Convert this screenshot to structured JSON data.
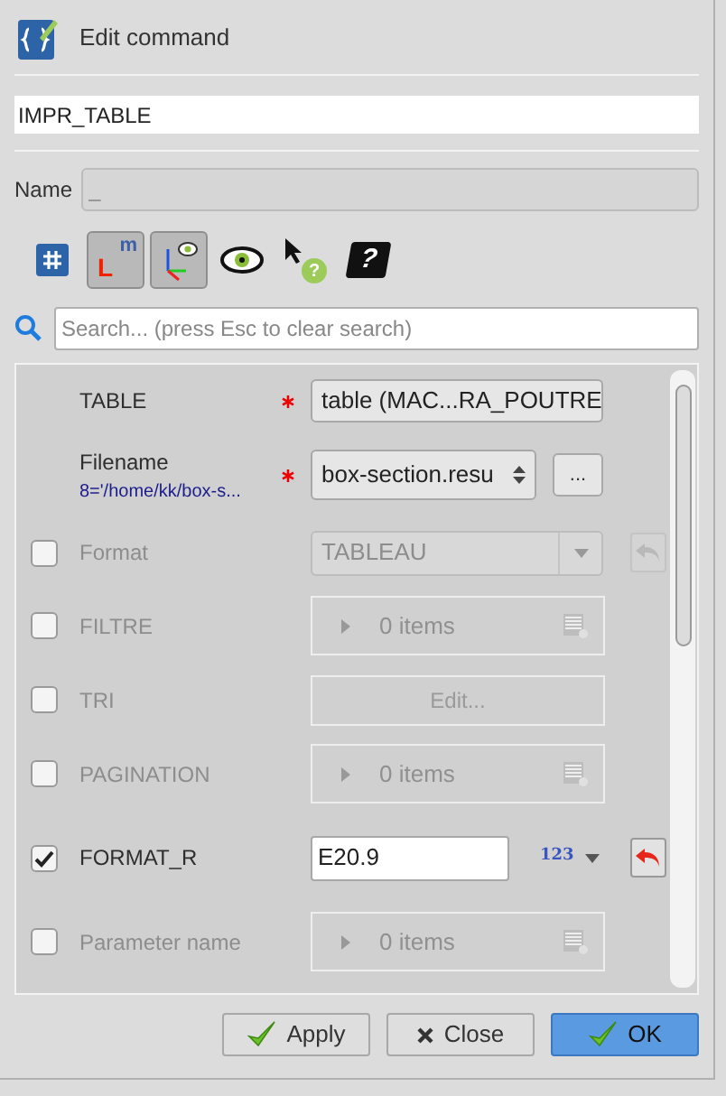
{
  "window": {
    "title": "Edit command"
  },
  "command": {
    "value": "IMPR_TABLE"
  },
  "name_field": {
    "label": "Name",
    "placeholder": "_"
  },
  "toolbar": [
    {
      "kind": "hash",
      "pressed": false
    },
    {
      "kind": "units",
      "pressed": true,
      "glyph_top": "m",
      "glyph_bottom": "L"
    },
    {
      "kind": "axes",
      "pressed": true
    },
    {
      "kind": "eye",
      "pressed": false
    },
    {
      "kind": "whatsthis",
      "pressed": false,
      "glyph": "?"
    },
    {
      "kind": "book",
      "pressed": false,
      "glyph": "?"
    }
  ],
  "search": {
    "placeholder": "Search... (press Esc to clear search)"
  },
  "params": [
    {
      "kind": "select",
      "label": "TABLE",
      "required": true,
      "value": "table (MAC...RA_POUTRE"
    },
    {
      "kind": "file",
      "label": "Filename",
      "required": true,
      "subtitle": "8='/home/kk/box-s...",
      "value": "box-section.resu",
      "browse": "..."
    },
    {
      "kind": "combo",
      "label": "Format",
      "checked": false,
      "value": "TABLEAU",
      "undo_active": false
    },
    {
      "kind": "list",
      "label": "FILTRE",
      "checked": false,
      "value": "0 items"
    },
    {
      "kind": "edit",
      "label": "TRI",
      "checked": false,
      "value": "Edit..."
    },
    {
      "kind": "list",
      "label": "PAGINATION",
      "checked": false,
      "value": "0 items"
    },
    {
      "kind": "text",
      "label": "FORMAT_R",
      "checked": true,
      "value": "E20.9",
      "type": "123",
      "undo_active": true
    },
    {
      "kind": "list",
      "label": "Parameter name",
      "checked": false,
      "value": "0 items"
    }
  ],
  "buttons": [
    {
      "kind": "apply",
      "label": "Apply",
      "default": false
    },
    {
      "kind": "close",
      "label": "Close",
      "default": false
    },
    {
      "kind": "ok",
      "label": "OK",
      "default": true
    }
  ]
}
